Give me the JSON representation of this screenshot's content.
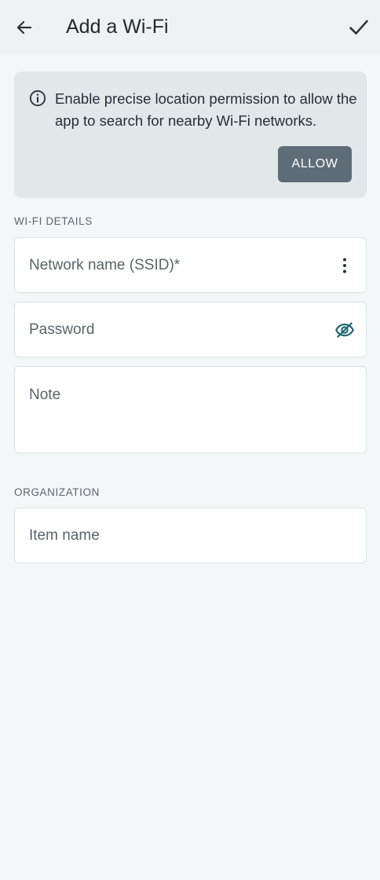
{
  "app_bar": {
    "title": "Add a Wi-Fi",
    "back_icon": "arrow-left-icon",
    "save_icon": "checkmark-icon"
  },
  "banner": {
    "icon": "info-circle-icon",
    "message": "Enable precise location permission to allow the app to search for nearby Wi-Fi networks.",
    "allow_label": "ALLOW"
  },
  "wifi_details": {
    "section_label": "WI-FI DETAILS",
    "ssid_placeholder": "Network name (SSID)*",
    "ssid_menu_icon": "more-vertical-icon",
    "password_placeholder": "Password",
    "password_toggle_icon": "eye-off-icon",
    "note_placeholder": "Note"
  },
  "organization": {
    "section_label": "ORGANIZATION",
    "item_name_placeholder": "Item name"
  },
  "colors": {
    "background": "#f4f7f8",
    "app_bar": "#eef2f3",
    "banner": "#e2e7ea",
    "allow_button": "#5f6d78",
    "accent_teal": "#1f6670",
    "field_border": "#dbe1e4"
  }
}
